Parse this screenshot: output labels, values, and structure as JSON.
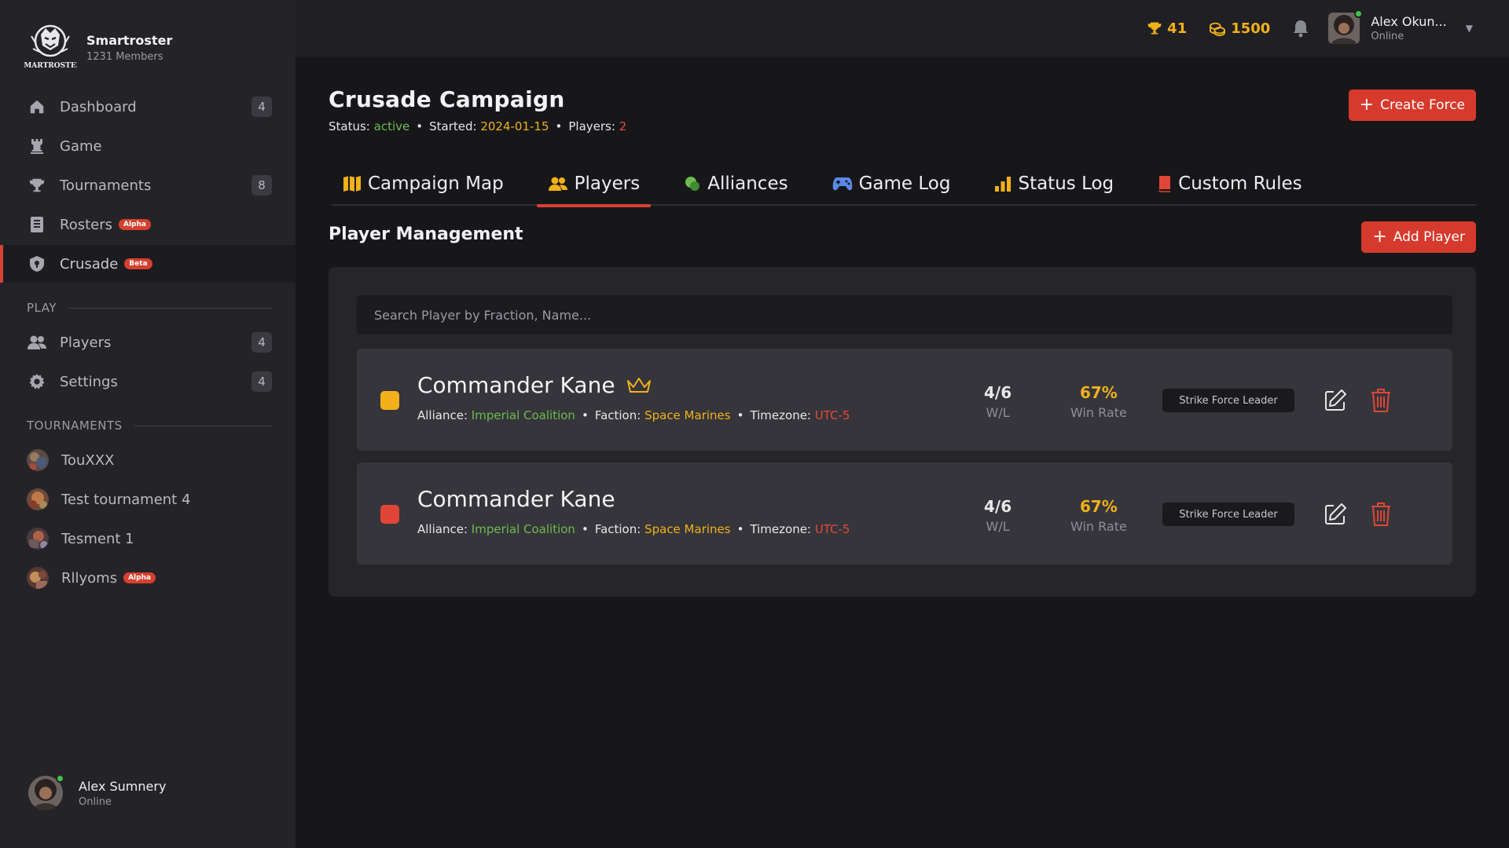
{
  "brand": {
    "name": "Smartroster",
    "members": "1231 Members",
    "logo_text": "SMARTROSTER"
  },
  "sidebar": {
    "nav": [
      {
        "label": "Dashboard",
        "count": "4",
        "icon": "home-icon"
      },
      {
        "label": "Game",
        "count": "",
        "icon": "chess-rook-icon"
      },
      {
        "label": "Tournaments",
        "count": "8",
        "icon": "trophy-icon"
      },
      {
        "label": "Rosters",
        "tag": "Alpha",
        "icon": "list-icon"
      },
      {
        "label": "Crusade",
        "tag": "Beta",
        "icon": "shield-icon",
        "active": true
      }
    ],
    "play_header": "PLAY",
    "play": [
      {
        "label": "Players",
        "count": "4",
        "icon": "users-icon"
      },
      {
        "label": "Settings",
        "count": "4",
        "icon": "gear-icon"
      }
    ],
    "tournaments_header": "TOURNAMENTS",
    "tournaments": [
      {
        "label": "TouXXX"
      },
      {
        "label": "Test tournament 4"
      },
      {
        "label": "Tesment 1"
      },
      {
        "label": "Rllyoms",
        "tag": "Alpha"
      }
    ],
    "user": {
      "name": "Alex Sumnery",
      "status": "Online"
    }
  },
  "topbar": {
    "trophies": "41",
    "coins": "1500",
    "user": {
      "name": "Alex Okun...",
      "status": "Online"
    }
  },
  "campaign": {
    "title": "Crusade Campaign",
    "status_label": "Status:",
    "status": "active",
    "started_label": "Started:",
    "started": "2024-01-15",
    "players_label": "Players:",
    "players": "2",
    "create_button": "Create Force"
  },
  "tabs": [
    {
      "label": "Campaign Map",
      "icon": "map-icon"
    },
    {
      "label": "Players",
      "icon": "users-icon",
      "active": true
    },
    {
      "label": "Alliances",
      "icon": "alliance-icon"
    },
    {
      "label": "Game Log",
      "icon": "gamepad-icon"
    },
    {
      "label": "Status Log",
      "icon": "bar-chart-icon"
    },
    {
      "label": "Custom Rules",
      "icon": "book-icon"
    }
  ],
  "players_section": {
    "title": "Player Management",
    "add_button": "Add Player",
    "search_placeholder": "Search Player by Fraction, Name...",
    "alliance_label": "Alliance:",
    "faction_label": "Faction:",
    "timezone_label": "Timezone:",
    "wl_label": "W/L",
    "winrate_label": "Win Rate",
    "players": [
      {
        "name": "Commander Kane",
        "leader": true,
        "color": "#f2b11b",
        "alliance": "Imperial Coalition",
        "faction": "Space Marines",
        "timezone": "UTC-5",
        "wl": "4/6",
        "winrate": "67%",
        "role": "Strike Force Leader"
      },
      {
        "name": "Commander Kane",
        "leader": false,
        "color": "#e04637",
        "alliance": "Imperial Coalition",
        "faction": "Space Marines",
        "timezone": "UTC-5",
        "wl": "4/6",
        "winrate": "67%",
        "role": "Strike Force Leader"
      }
    ]
  },
  "colors": {
    "accent_red": "#d63a2d",
    "gold": "#f1b11a",
    "green": "#6fba4f",
    "online": "#43c24a"
  }
}
